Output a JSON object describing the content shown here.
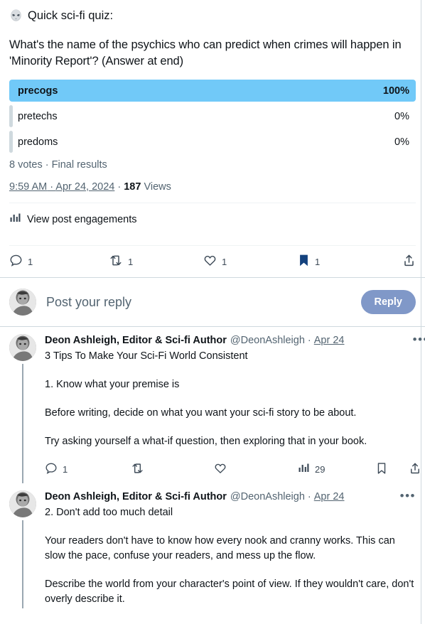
{
  "post": {
    "emoji_name": "alien-emoji",
    "headline": "Quick sci-fi quiz:",
    "question": "What's the name of the psychics who can predict when crimes will happen in 'Minority Report'? (Answer at end)",
    "poll": {
      "options": [
        {
          "label": "precogs",
          "percent": "100%",
          "fill": 100,
          "winner": true
        },
        {
          "label": "pretechs",
          "percent": "0%",
          "fill": 0,
          "winner": false
        },
        {
          "label": "predoms",
          "percent": "0%",
          "fill": 0,
          "winner": false
        }
      ],
      "meta": "8 votes · Final results"
    },
    "timestamp": {
      "time": "9:59 AM",
      "sep1": " · ",
      "date": "Apr 24, 2024",
      "sep2": " · ",
      "views_count": "187",
      "views_label": " Views"
    },
    "engagements_label": "View post engagements",
    "actions": {
      "reply": "1",
      "retweet": "1",
      "like": "1",
      "bookmark": "1",
      "share": ""
    }
  },
  "composer": {
    "placeholder": "Post your reply",
    "reply_button": "Reply"
  },
  "replies": [
    {
      "name": "Deon Ashleigh, Editor & Sci-fi Author",
      "handle": "@DeonAshleigh",
      "dot": "·",
      "date": "Apr 24",
      "more": "•••",
      "title": "3 Tips To Make Your Sci-Fi World Consistent",
      "paragraphs": [
        "1. Know what your premise is",
        "Before writing, decide on what you want your sci-fi story to be about.",
        "Try asking yourself a what-if question, then exploring that in your book."
      ],
      "actions": {
        "reply": "1",
        "retweet": "",
        "like": "",
        "views": "29",
        "bookmark": "",
        "share": ""
      }
    },
    {
      "name": "Deon Ashleigh, Editor & Sci-fi Author",
      "handle": "@DeonAshleigh",
      "dot": "·",
      "date": "Apr 24",
      "more": "•••",
      "title": "2. Don't add too much detail",
      "paragraphs": [
        "Your readers don't have to know how every nook and cranny works. This can slow the pace, confuse your readers, and mess up the flow.",
        "Describe the world from your character's point of view. If they wouldn't care, don't overly describe it."
      ],
      "actions": {}
    }
  ],
  "colors": {
    "poll_winner": "#71c9f8",
    "poll_empty": "#cfd9de",
    "bookmark_active": "#14427e",
    "reply_button": "#8098c8",
    "icon": "#3d4a57",
    "muted_text": "#536471"
  }
}
